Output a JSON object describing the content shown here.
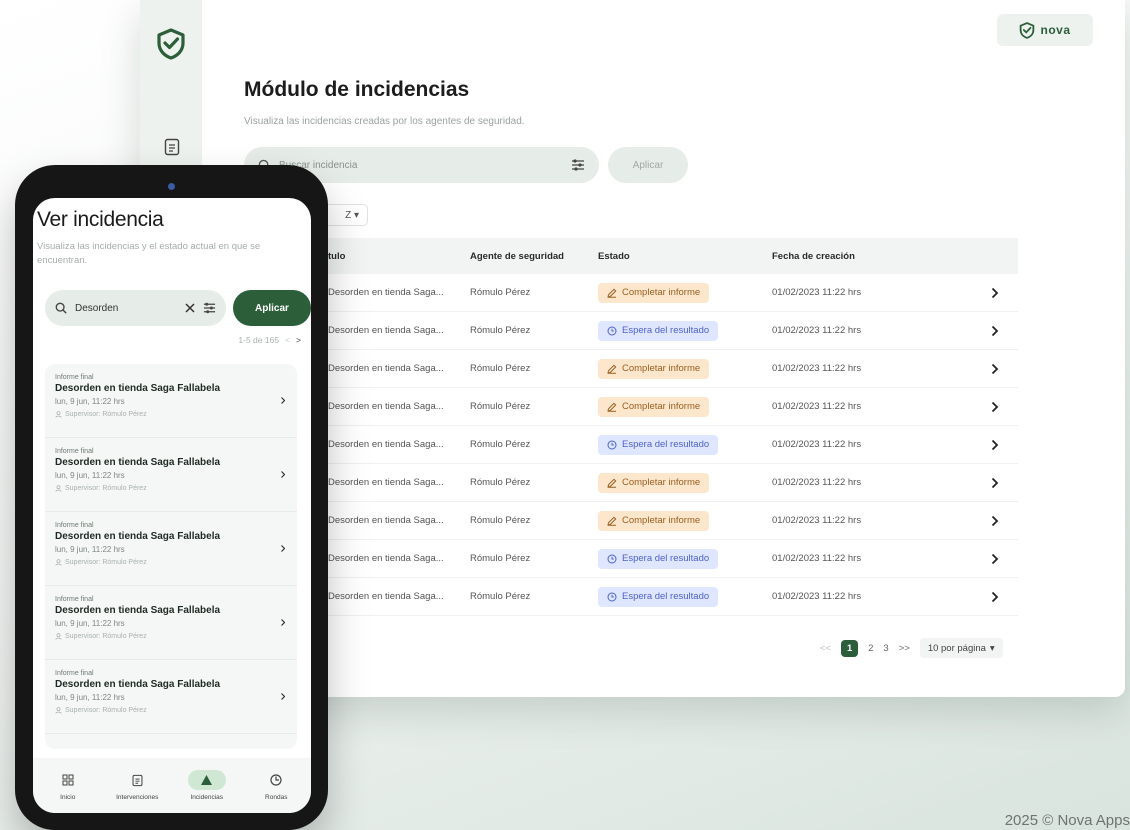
{
  "desktop": {
    "brand_wordmark": "nova",
    "page_title": "Módulo de incidencias",
    "page_subtitle": "Visualiza las incidencias creadas por los agentes de seguridad.",
    "search_placeholder": "Buscar incidencia",
    "apply_label": "Aplicar",
    "sort_label": "Z",
    "table": {
      "headers": [
        "tulo",
        "Agente de seguridad",
        "Estado",
        "Fecha de creación"
      ],
      "rows": [
        {
          "title": "Desorden en tienda Saga...",
          "agent": "Rómulo Pérez",
          "status": "Completar informe",
          "status_kind": "orange",
          "date": "01/02/2023 11:22 hrs"
        },
        {
          "title": "Desorden en tienda Saga...",
          "agent": "Rómulo Pérez",
          "status": "Espera del resultado",
          "status_kind": "blue",
          "date": "01/02/2023 11:22 hrs"
        },
        {
          "title": "Desorden en tienda Saga...",
          "agent": "Rómulo Pérez",
          "status": "Completar informe",
          "status_kind": "orange",
          "date": "01/02/2023 11:22 hrs"
        },
        {
          "title": "Desorden en tienda Saga...",
          "agent": "Rómulo Pérez",
          "status": "Completar informe",
          "status_kind": "orange",
          "date": "01/02/2023 11:22 hrs"
        },
        {
          "title": "Desorden en tienda Saga...",
          "agent": "Rómulo Pérez",
          "status": "Espera del resultado",
          "status_kind": "blue",
          "date": "01/02/2023 11:22 hrs"
        },
        {
          "title": "Desorden en tienda Saga...",
          "agent": "Rómulo Pérez",
          "status": "Completar informe",
          "status_kind": "orange",
          "date": "01/02/2023 11:22 hrs"
        },
        {
          "title": "Desorden en tienda Saga...",
          "agent": "Rómulo Pérez",
          "status": "Completar informe",
          "status_kind": "orange",
          "date": "01/02/2023 11:22 hrs"
        },
        {
          "title": "Desorden en tienda Saga...",
          "agent": "Rómulo Pérez",
          "status": "Espera del resultado",
          "status_kind": "blue",
          "date": "01/02/2023 11:22 hrs"
        },
        {
          "title": "Desorden en tienda Saga...",
          "agent": "Rómulo Pérez",
          "status": "Espera del resultado",
          "status_kind": "blue",
          "date": "01/02/2023 11:22 hrs"
        }
      ]
    },
    "pagination": {
      "prev": "<<",
      "pages": [
        "1",
        "2",
        "3"
      ],
      "active_page": "1",
      "next": ">>",
      "per_page": "10 por página"
    }
  },
  "mobile": {
    "title": "Ver incidencia",
    "subtitle": "Visualiza las incidencias y el estado actual en que se encuentran.",
    "search_value": "Desorden",
    "apply_label": "Aplicar",
    "pagination_text": "1-5 de 165",
    "items": [
      {
        "tag": "Informe final",
        "title": "Desorden en tienda Saga Fallabela",
        "date": "lun, 9 jun, 11:22 hrs",
        "supervisor": "Supervisor: Rómulo Pérez"
      },
      {
        "tag": "Informe final",
        "title": "Desorden en tienda Saga Fallabela",
        "date": "lun, 9 jun, 11:22 hrs",
        "supervisor": "Supervisor: Rómulo Pérez"
      },
      {
        "tag": "Informe final",
        "title": "Desorden en tienda Saga Fallabela",
        "date": "lun, 9 jun, 11:22 hrs",
        "supervisor": "Supervisor: Rómulo Pérez"
      },
      {
        "tag": "Informe final",
        "title": "Desorden en tienda Saga Fallabela",
        "date": "lun, 9 jun, 11:22 hrs",
        "supervisor": "Supervisor: Rómulo Pérez"
      },
      {
        "tag": "Informe final",
        "title": "Desorden en tienda Saga Fallabela",
        "date": "lun, 9 jun, 11:22 hrs",
        "supervisor": "Supervisor: Rómulo Pérez"
      }
    ],
    "nav": [
      {
        "label": "Inicio",
        "icon": "grid-icon",
        "active": false
      },
      {
        "label": "Intervenciones",
        "icon": "document-icon",
        "active": false
      },
      {
        "label": "Incidencias",
        "icon": "warning-icon",
        "active": true
      },
      {
        "label": "Rondas",
        "icon": "clock-icon",
        "active": false
      }
    ]
  },
  "footer_note": "2025 © Nova Apps",
  "colors": {
    "brand_green": "#2c5e3a",
    "status_orange_bg": "#fde7cc",
    "status_blue_bg": "#dfe6ff"
  }
}
